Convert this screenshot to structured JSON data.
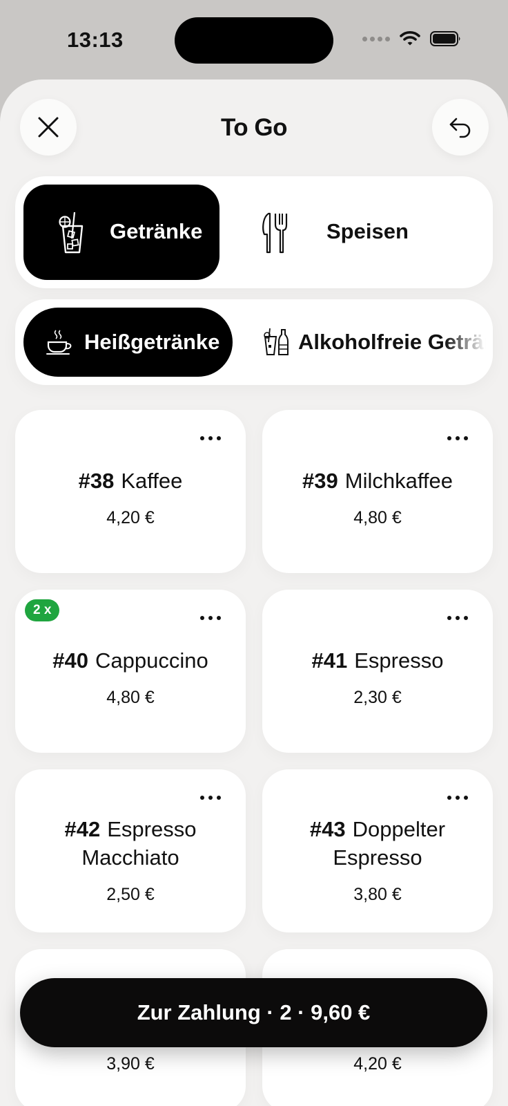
{
  "status_bar": {
    "time": "13:13"
  },
  "header": {
    "title": "To Go"
  },
  "categories": [
    {
      "label": "Getränke",
      "icon": "cocktail-glass-icon",
      "active": true
    },
    {
      "label": "Speisen",
      "icon": "knife-fork-icon",
      "active": false
    }
  ],
  "subcategories": [
    {
      "label": "Heißgetränke",
      "icon": "coffee-cup-icon",
      "active": true
    },
    {
      "label": "Alkoholfreie Getränke",
      "icon": "soft-drinks-icon",
      "active": false
    }
  ],
  "products": [
    {
      "number": "#38",
      "name": "Kaffee",
      "price": "4,20 €"
    },
    {
      "number": "#39",
      "name": "Milchkaffee",
      "price": "4,80 €"
    },
    {
      "number": "#40",
      "name": "Cappuccino",
      "price": "4,80 €",
      "badge": "2 x"
    },
    {
      "number": "#41",
      "name": "Espresso",
      "price": "2,30 €"
    },
    {
      "number": "#42",
      "name_line1": "Espresso",
      "name_line2": "Macchiato",
      "price": "2,50 €"
    },
    {
      "number": "#43",
      "name_line1": "Doppelter",
      "name_line2": "Espresso",
      "price": "3,80 €"
    },
    {
      "price": "3,90 €"
    },
    {
      "price": "4,20 €"
    }
  ],
  "checkout": {
    "label": "Zur Zahlung · 2 · 9,60 €"
  },
  "colors": {
    "accent": "#000000",
    "badge": "#1fa53f",
    "background": "#f2f1f0"
  }
}
